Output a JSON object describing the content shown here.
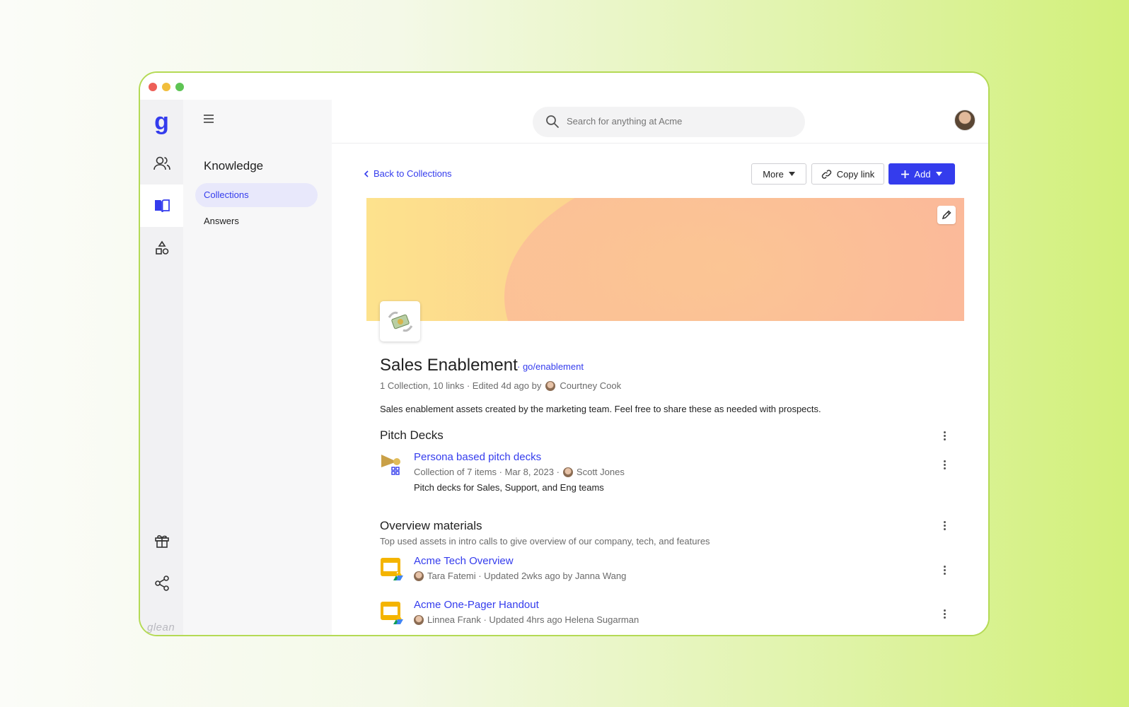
{
  "rail": {
    "logo": "g",
    "brand": "glean"
  },
  "subnav": {
    "title": "Knowledge",
    "items": [
      {
        "label": "Collections",
        "active": true
      },
      {
        "label": "Answers",
        "active": false
      }
    ]
  },
  "search": {
    "placeholder": "Search for anything at Acme"
  },
  "toolbar": {
    "back_label": "Back to Collections",
    "more_label": "More",
    "copy_label": "Copy link",
    "add_label": "Add"
  },
  "collection": {
    "title": "Sales Enablement",
    "golink": "· go/enablement",
    "meta_prefix": "1 Collection, 10 links · Edited 4d ago by",
    "meta_author": "Courtney Cook",
    "description": "Sales enablement assets created by the marketing team. Feel free to share these as needed with prospects."
  },
  "sections": [
    {
      "title": "Pitch Decks",
      "items": [
        {
          "title": "Persona based pitch decks",
          "meta_prefix": "Collection of 7 items · Mar 8, 2023 ·",
          "meta_author": "Scott Jones",
          "description": "Pitch decks for Sales, Support, and Eng teams"
        }
      ]
    },
    {
      "title": "Overview materials",
      "subtitle": "Top used assets in intro calls to give overview of our company, tech, and features",
      "items": [
        {
          "title": "Acme Tech Overview",
          "meta": "Tara Fatemi · Updated 2wks ago by Janna Wang"
        },
        {
          "title": "Acme One-Pager Handout",
          "meta": "Linnea Frank · Updated 4hrs ago Helena Sugarman"
        }
      ]
    }
  ],
  "colors": {
    "accent": "#343ced",
    "window_border": "#b4da55"
  }
}
